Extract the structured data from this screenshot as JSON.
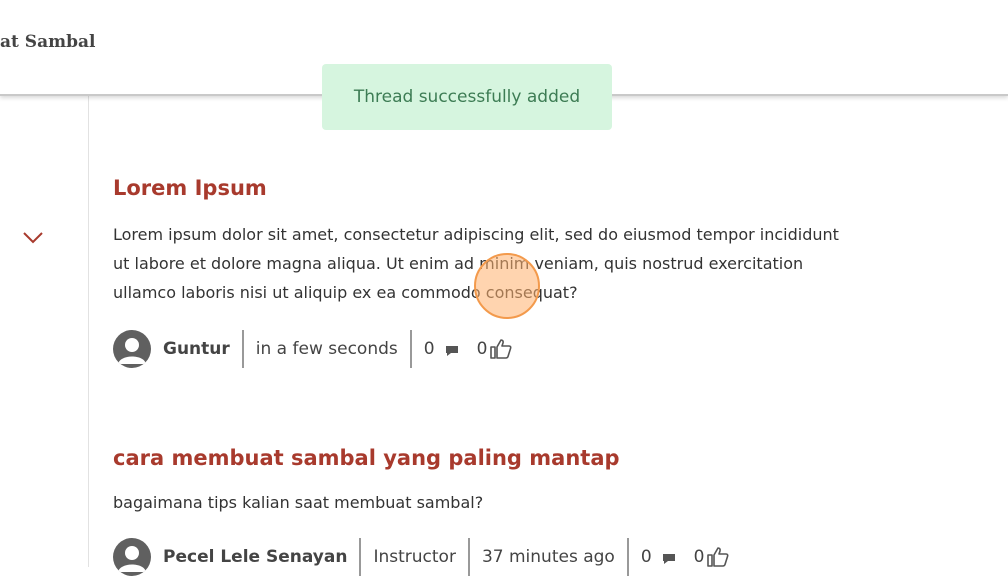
{
  "header": {
    "title": "at Sambal"
  },
  "toast": {
    "message": "Thread successfully added"
  },
  "threads": [
    {
      "title": "Lorem Ipsum",
      "body_lines": [
        "Lorem ipsum dolor sit amet, consectetur adipiscing elit, sed do eiusmod tempor incididunt",
        "ut labore et dolore magna aliqua. Ut enim ad minim veniam, quis nostrud exercitation",
        "ullamco laboris nisi ut aliquip ex ea commodo consequat?"
      ],
      "author": "Guntur",
      "role": "",
      "time": "in a few seconds",
      "comments": "0",
      "likes": "0"
    },
    {
      "title": "cara membuat sambal yang paling mantap",
      "body_lines": [
        "bagaimana tips kalian saat membuat sambal?"
      ],
      "author": "Pecel Lele Senayan",
      "role": "Instructor",
      "time": "37 minutes ago",
      "comments": "0",
      "likes": "0"
    }
  ],
  "colors": {
    "accent": "#a83a2d",
    "toast_bg": "#d6f5df",
    "toast_text": "#3d7c54"
  }
}
